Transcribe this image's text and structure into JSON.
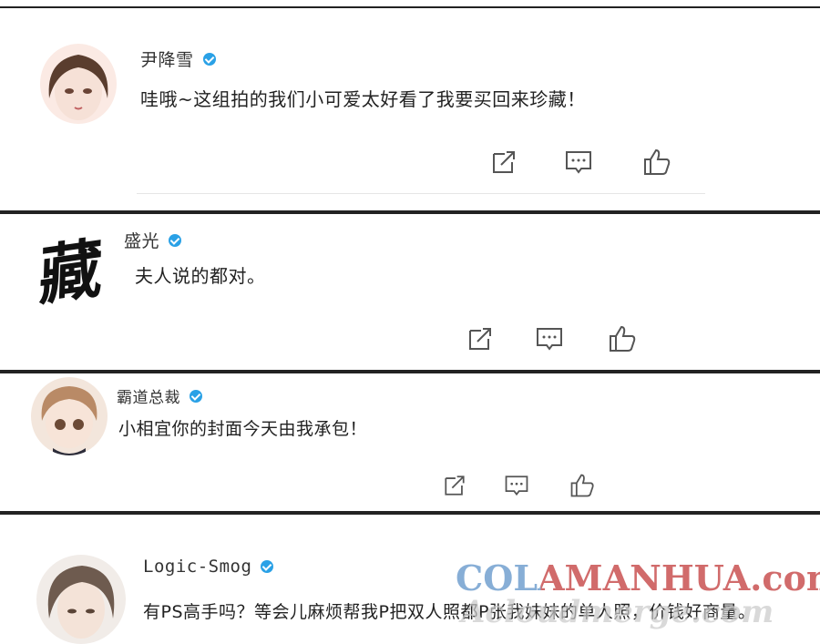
{
  "comments": [
    {
      "name": "尹降雪",
      "text": "哇哦~这组拍的我们小可爱太好看了我要买回来珍藏！"
    },
    {
      "name": "盛光",
      "text": "夫人说的都对。",
      "avatar_glyph": "藏"
    },
    {
      "name": "霸道总裁",
      "text": "小相宜你的封面今天由我承包！"
    },
    {
      "name": "Logic-Smog",
      "text": "有PS高手吗？等会儿麻烦帮我P把双人照都P张我妹妹的单人照，价钱好商量。"
    }
  ],
  "icons": {
    "share": "share-icon",
    "reply": "comment-icon",
    "like": "thumbs-up-icon",
    "verified": "verified-badge-icon"
  },
  "watermark": {
    "line1": "COLAMANHUA.com",
    "line2": "Acloudmerge.com"
  },
  "colors": {
    "verified": "#2aa1e6",
    "icon": "#555555",
    "watermark_blue": "#5f93c9",
    "watermark_red": "#c23a3a"
  }
}
